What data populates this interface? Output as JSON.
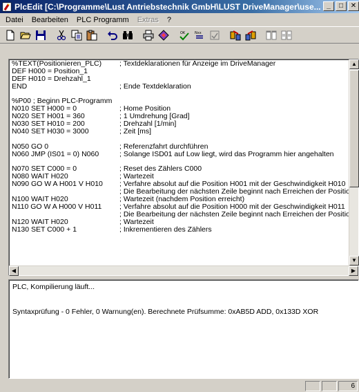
{
  "window": {
    "title": "PlcEdit [C:\\Programme\\Lust Antriebstechnik GmbH\\LUST DriveManager\\use...",
    "minimize_glyph": "_",
    "maximize_glyph": "□",
    "close_glyph": "✕"
  },
  "menu": {
    "items": [
      "Datei",
      "Bearbeiten",
      "PLC Programm",
      "Extras",
      "?"
    ]
  },
  "toolbar": {
    "buttons": [
      "new-file",
      "open-folder",
      "save-disk",
      "cut-scissors",
      "copy",
      "paste",
      "undo",
      "find-binoculars",
      "print",
      "compile",
      "check",
      "nxx",
      "ok",
      "download",
      "upload",
      "window-1",
      "window-2"
    ]
  },
  "editor": {
    "lines": [
      {
        "code": "%TEXT(Positionieren_PLC)",
        "comment": "; Textdeklarationen für Anzeige im DriveManager"
      },
      {
        "code": "DEF H000 = Position_1",
        "comment": ""
      },
      {
        "code": "DEF H010 = Drehzahl_1",
        "comment": ""
      },
      {
        "code": "END",
        "comment": "; Ende Textdeklaration"
      },
      {
        "code": "",
        "comment": ""
      },
      {
        "code": "%P00      ; Beginn PLC-Programm",
        "comment": ""
      },
      {
        "code": "N010 SET H000 = 0",
        "comment": "; Home Position"
      },
      {
        "code": "N020 SET H001 = 360",
        "comment": "; 1 Umdrehung [Grad]"
      },
      {
        "code": "N030 SET H010 = 200",
        "comment": "; Drehzahl [1/min]"
      },
      {
        "code": "N040 SET H030 = 3000",
        "comment": "; Zeit [ms]"
      },
      {
        "code": "",
        "comment": ""
      },
      {
        "code": "N050 GO 0",
        "comment": "; Referenzfahrt durchführen"
      },
      {
        "code": "N060 JMP (IS01 = 0) N060",
        "comment": "; Solange ISD01 auf Low liegt, wird das Programm hier angehalten"
      },
      {
        "code": "",
        "comment": ""
      },
      {
        "code": "N070 SET C000 = 0",
        "comment": "; Reset des Zählers C000"
      },
      {
        "code": "N080 WAIT H020",
        "comment": "; Wartezeit"
      },
      {
        "code": "N090 GO W A H001 V H010",
        "comment": "; Verfahre absolut auf die Position H001 mit der Geschwindigkeit H010"
      },
      {
        "code": "",
        "comment": "; Die Bearbeitung der nächsten Zeile beginnt nach Erreichen der Position"
      },
      {
        "code": "N100 WAIT H020",
        "comment": "; Wartezeit (nachdem Position erreicht)"
      },
      {
        "code": "N110 GO W A H000 V H011",
        "comment": "; Verfahre absolut auf die Position H000 mit der Geschwindigkeit H011"
      },
      {
        "code": "",
        "comment": "; Die Bearbeitung der nächsten Zeile beginnt nach Erreichen der Position"
      },
      {
        "code": "N120 WAIT H020",
        "comment": "; Wartezeit"
      },
      {
        "code": "N130 SET C000 + 1",
        "comment": "; Inkrementieren des Zählers"
      }
    ]
  },
  "output": {
    "lines": [
      "PLC, Kompilierung läuft...",
      "",
      "",
      "Syntaxprüfung - 0 Fehler, 0 Warnung(en). Berechnete Prüfsumme: 0xAB5D ADD, 0x133D XOR"
    ]
  },
  "status": {
    "pane1": "",
    "pane2": "",
    "line_number": "6"
  },
  "colors": {
    "title_active": "#0a246a",
    "face": "#d4d0c8",
    "window": "#ffffff"
  }
}
